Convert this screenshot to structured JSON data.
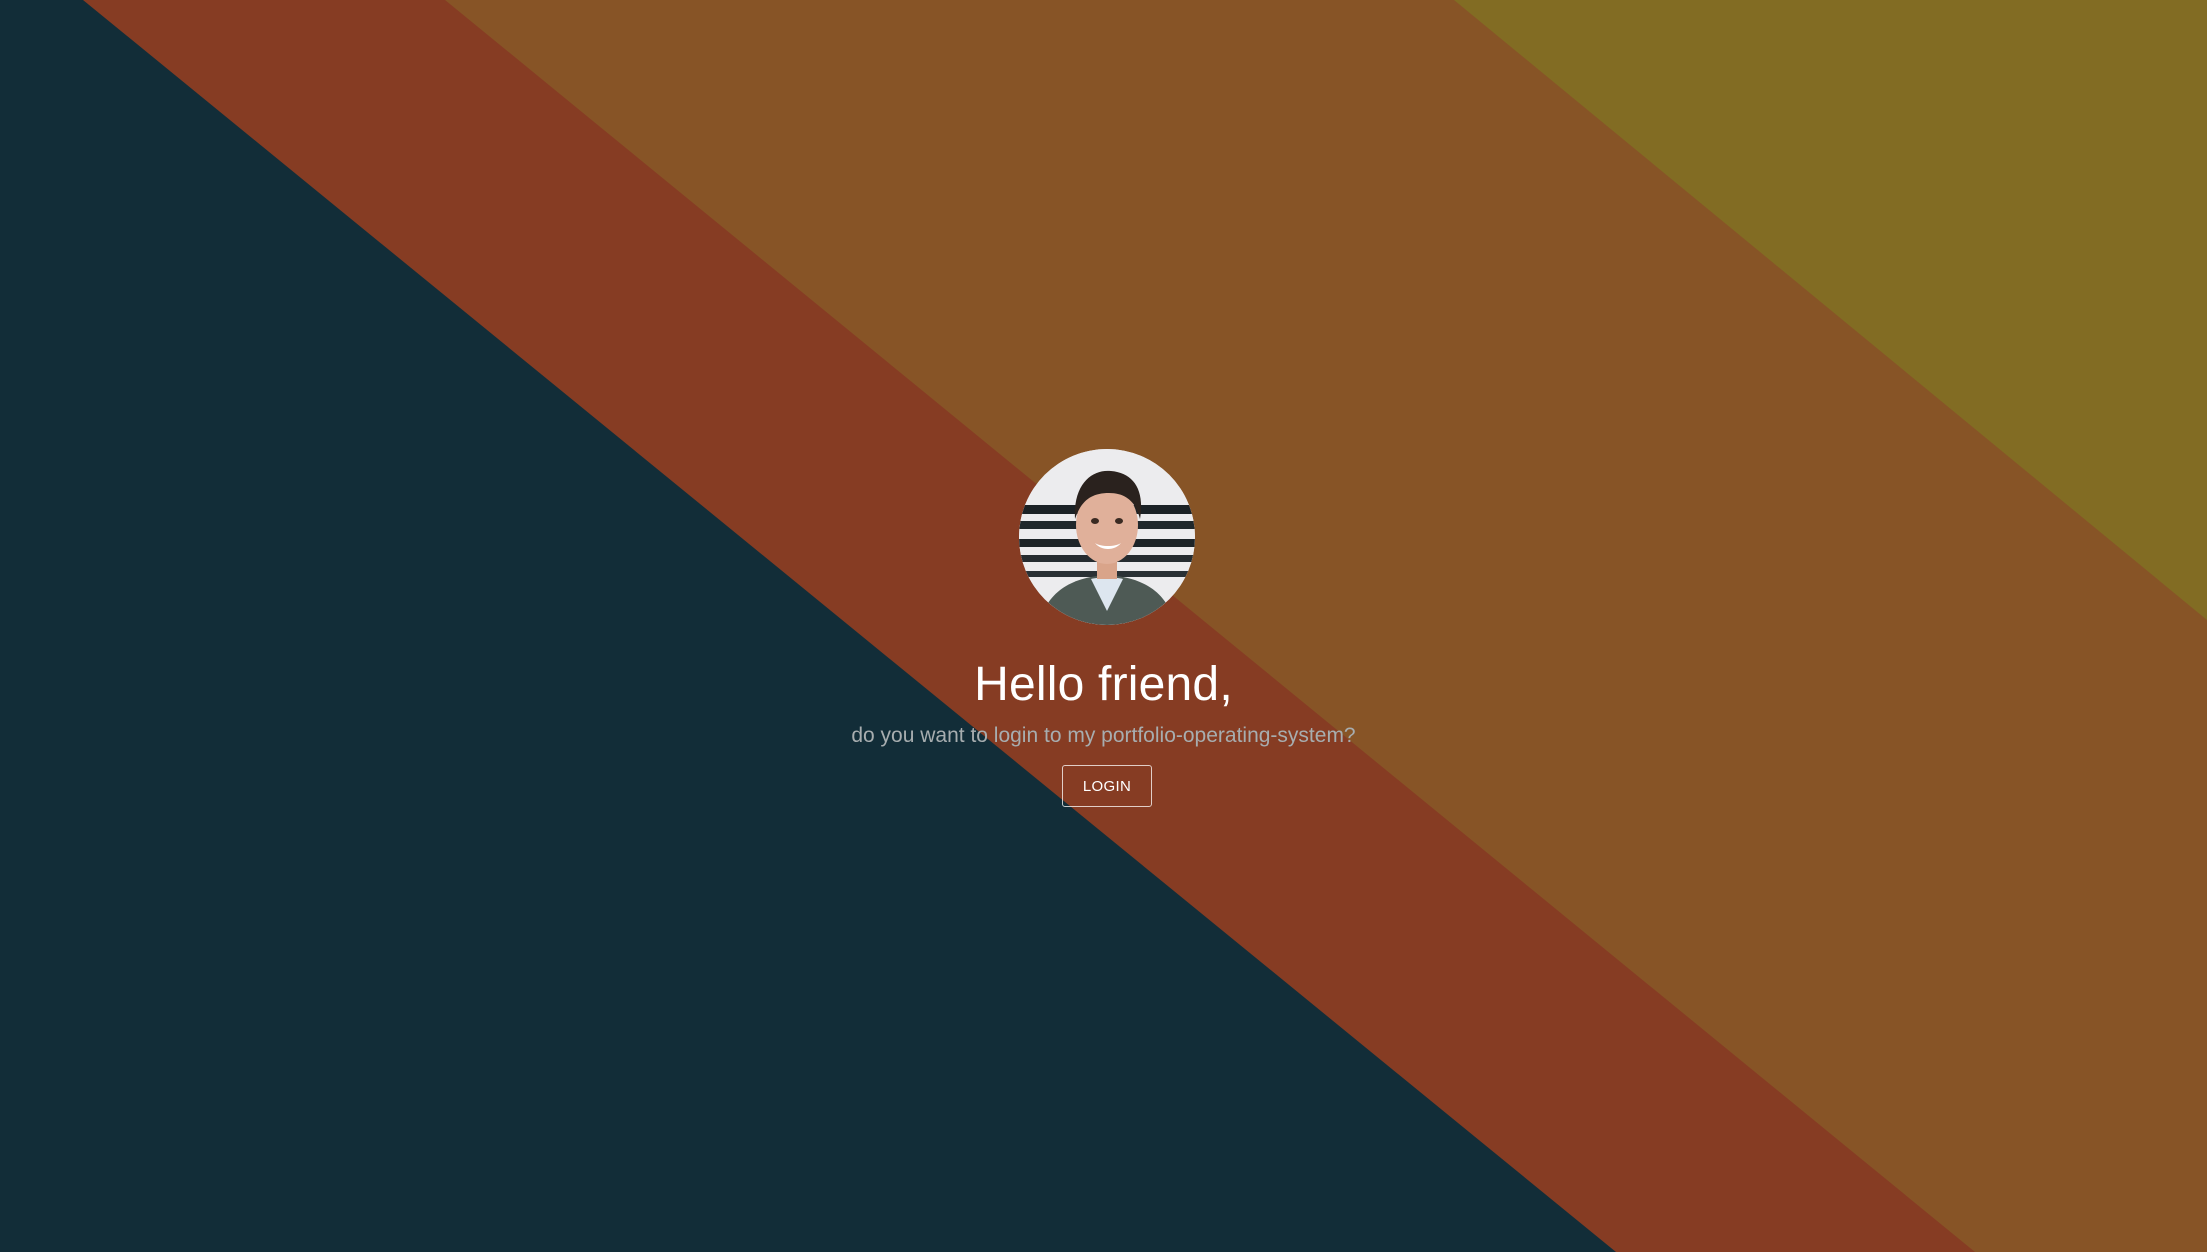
{
  "background": {
    "colors": {
      "dark_teal": "#122d38",
      "rust": "#863c23",
      "amber": "#875426",
      "olive": "#826c23"
    }
  },
  "profile": {
    "avatar_icon": "profile-photo"
  },
  "login_screen": {
    "greeting": "Hello friend,",
    "subtitle": "do you want to login to my portfolio-operating-system?",
    "login_label": "LOGIN"
  }
}
